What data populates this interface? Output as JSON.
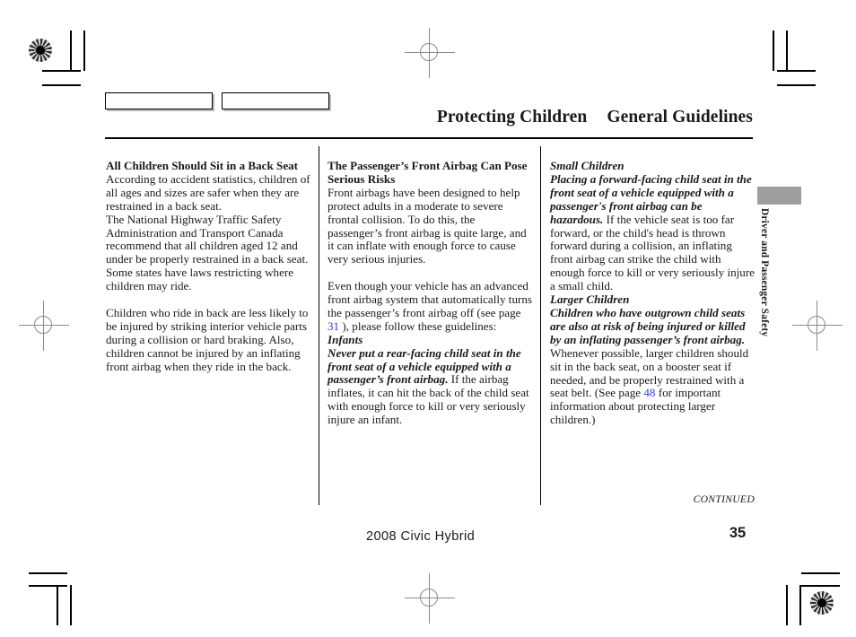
{
  "header": {
    "title": "Protecting Children",
    "subtitle": "General Guidelines"
  },
  "side_tab": {
    "label": "Driver and Passenger Safety",
    "color": "#9e9e9e"
  },
  "columns": [
    {
      "id": "column-one",
      "blocks": [
        {
          "type": "heading",
          "text": "All Children Should Sit in a Back Seat"
        },
        {
          "type": "paragraph",
          "text": "According to accident statistics, children of all ages and sizes are safer when they are restrained in a back seat."
        },
        {
          "type": "paragraph",
          "text": "The National Highway Traffic Safety Administration and Transport Canada recommend that all children aged 12 and under be properly restrained in a back seat. Some states have laws restricting where children may ride."
        },
        {
          "type": "paragraph-spaced",
          "text": "Children who ride in back are less likely to be injured by striking interior vehicle parts during a collision or hard braking. Also, children cannot be injured by an inflating front airbag when they ride in the back."
        }
      ]
    },
    {
      "id": "column-two",
      "blocks": [
        {
          "type": "heading",
          "text": "The Passenger’s Front Airbag Can Pose Serious Risks"
        },
        {
          "type": "paragraph",
          "text": "Front airbags have been designed to help protect adults in a moderate to severe frontal collision. To do this, the passenger’s front airbag is quite large, and it can inflate with enough force to cause very serious injuries."
        },
        {
          "type": "paragraph-xref",
          "lead": "Even though your vehicle has an advanced front airbag system that automatically turns the passenger’s front airbag off (see page ",
          "xref": "31",
          "tail": " ), please follow these guidelines:"
        },
        {
          "type": "subheading",
          "text": "Infants"
        },
        {
          "type": "paragraph-warn",
          "warn": "Never put a rear-facing child seat in the front seat of a vehicle equipped with a passenger’s front airbag.",
          "rest": " If the airbag inflates, it can hit the back of the child seat with enough force to kill or very seriously injure an infant."
        }
      ]
    },
    {
      "id": "column-three",
      "blocks": [
        {
          "type": "subheading",
          "text": "Small Children"
        },
        {
          "type": "paragraph-warn",
          "warn": "Placing a forward-facing child seat in the front seat of a vehicle equipped with a passenger's front airbag can be hazardous.",
          "rest": " If the vehicle seat is too far forward, or the child's head is thrown forward during a collision, an inflating front airbag can strike the child with enough force to kill or very seriously injure a small child."
        },
        {
          "type": "subheading-spaced",
          "text": "Larger Children"
        },
        {
          "type": "paragraph-warn-xref",
          "warn": "Children who have outgrown child seats are also at risk of being injured or killed by an inflating passenger’s front airbag.",
          "lead": " Whenever possible, larger children should sit in the back seat, on a booster seat if needed, and be properly restrained with a seat belt. (See page ",
          "xref": "48",
          "tail": " for important information about protecting larger children.)"
        }
      ]
    }
  ],
  "footer": {
    "continued": "CONTINUED",
    "model": "2008  Civic  Hybrid",
    "page_number": "35"
  }
}
